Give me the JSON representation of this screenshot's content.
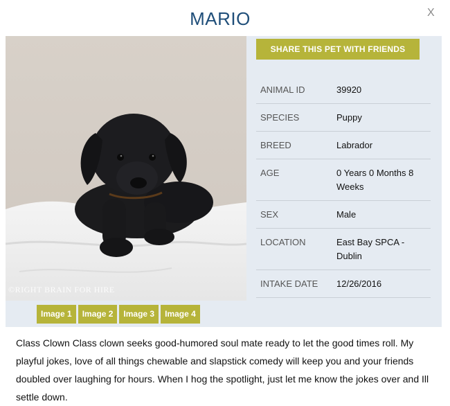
{
  "header": {
    "title": "MARIO",
    "close_label": "X"
  },
  "gallery": {
    "watermark": "©RIGHT BRAIN FOR HIRE",
    "thumbnails": [
      "Image 1",
      "Image 2",
      "Image 3",
      "Image 4"
    ]
  },
  "share_button": "SHARE THIS PET WITH FRIENDS",
  "details": [
    {
      "label": "ANIMAL ID",
      "value": "39920"
    },
    {
      "label": "SPECIES",
      "value": "Puppy"
    },
    {
      "label": "BREED",
      "value": "Labrador"
    },
    {
      "label": "AGE",
      "value": "0 Years 0 Months 8 Weeks"
    },
    {
      "label": "SEX",
      "value": "Male"
    },
    {
      "label": "LOCATION",
      "value": "East Bay SPCA - Dublin"
    },
    {
      "label": "INTAKE DATE",
      "value": "12/26/2016"
    }
  ],
  "description": "Class Clown Class clown seeks good-humored soul mate ready to let the good times roll. My playful jokes, love of all things chewable and slapstick comedy will keep you and your friends doubled over laughing for hours. When I hog the spotlight, just let me know the jokes over and Ill settle down.",
  "colors": {
    "title": "#1f4e79",
    "accent": "#b6b43a",
    "panel": "#e5ebf2"
  }
}
